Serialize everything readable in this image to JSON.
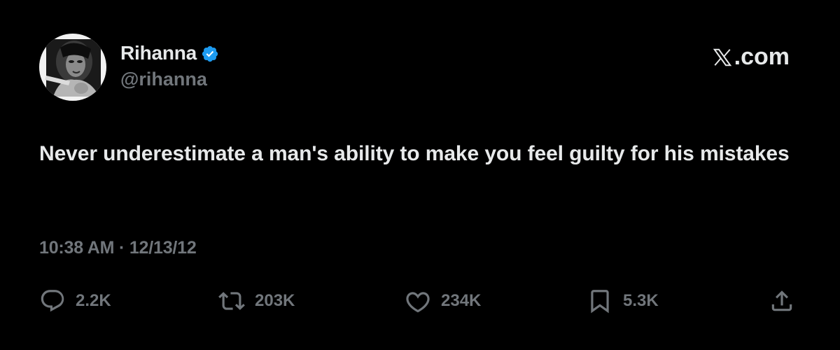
{
  "author": {
    "display_name": "Rihanna",
    "handle": "@rihanna",
    "verified": true
  },
  "brand": {
    "label": ".com",
    "icon": "x-logo-icon"
  },
  "tweet": {
    "text": "Never underestimate a man's ability to make you feel guilty for his mistakes",
    "timestamp": "10:38 AM · 12/13/12"
  },
  "actions": {
    "replies": "2.2K",
    "retweets": "203K",
    "likes": "234K",
    "bookmarks": "5.3K"
  },
  "colors": {
    "background": "#000000",
    "text_primary": "#e7e9ea",
    "text_secondary": "#71767b",
    "verified_blue": "#1d9bf0"
  }
}
